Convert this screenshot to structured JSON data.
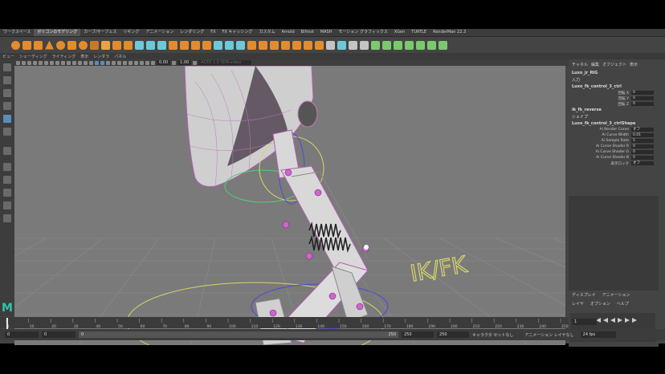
{
  "menubar": {
    "items": [
      "ワークスペース",
      "ポリゴンのモデリング",
      "カーブ/サーフェス",
      "リギング",
      "アニメーション",
      "レンダリング",
      "FX",
      "FX キャッシング",
      "カスタム",
      "Arnold",
      "Bifrost",
      "MASH",
      "モーション グラフィックス",
      "XGen",
      "TURTLE",
      "RenderMan 22.3"
    ],
    "active_index": 1
  },
  "viewport_menu": [
    "ビュー",
    "シェーディング",
    "ライティング",
    "表示",
    "レンダラ",
    "パネル"
  ],
  "viewport_fields": {
    "near": "0.00",
    "far": "1.00",
    "colorspace": "ACES 1.0 SDR-video"
  },
  "overlay_text": "IK/FK",
  "attribute_editor": {
    "tabs": [
      "チャネル",
      "編集",
      "オブジェクト",
      "表示"
    ],
    "node": "Luxo_jr_RIG",
    "section_input": "入力",
    "control": "Luxo_fk_control_3_ctrl",
    "fields_rotate": [
      {
        "label": "回転 X",
        "value": "0"
      },
      {
        "label": "回転 Y",
        "value": "0"
      },
      {
        "label": "回転 Z",
        "value": "0"
      }
    ],
    "ik_node": "ik_fk_reverse",
    "section_shape": "シェイプ",
    "shape_node": "Luxo_fk_control_3_ctrlShape",
    "shape_fields": [
      {
        "label": "Ai Render Curve",
        "value": "オフ"
      },
      {
        "label": "Ai Curve Width",
        "value": "0.01"
      },
      {
        "label": "Ai Sample Rate",
        "value": "5"
      },
      {
        "label": "Ai Curve Shader R",
        "value": "0"
      },
      {
        "label": "Ai Curve Shader G",
        "value": "0"
      },
      {
        "label": "Ai Curve Shader B",
        "value": "0"
      },
      {
        "label": "表示ロック",
        "value": "オフ"
      }
    ]
  },
  "layer_panel": {
    "tabs": [
      "ディスプレイ",
      "アニメーション"
    ],
    "menu": [
      "レイヤ",
      "オプション",
      "ヘルプ"
    ]
  },
  "timeline": {
    "ticks": [
      "1",
      "10",
      "20",
      "30",
      "40",
      "50",
      "60",
      "70",
      "80",
      "90",
      "100",
      "110",
      "120",
      "130",
      "140",
      "150",
      "160",
      "170",
      "180",
      "190",
      "200",
      "210",
      "220",
      "230",
      "240",
      "250"
    ],
    "current_frame": "1"
  },
  "range": {
    "start": "0",
    "playback_start": "0",
    "range_label": "0",
    "range_end_label": "250",
    "playback_end": "250",
    "end": "250",
    "character_set": "キャラクタ セットなし",
    "anim_layer": "アニメーション レイヤなし",
    "fps": "24 fps"
  },
  "app_logo": "M",
  "colors": {
    "accent": "#5b8db8",
    "ikfk": "#d7d46a",
    "rig_wire": "#d07ad0",
    "maya_green": "#2dc7a8"
  }
}
